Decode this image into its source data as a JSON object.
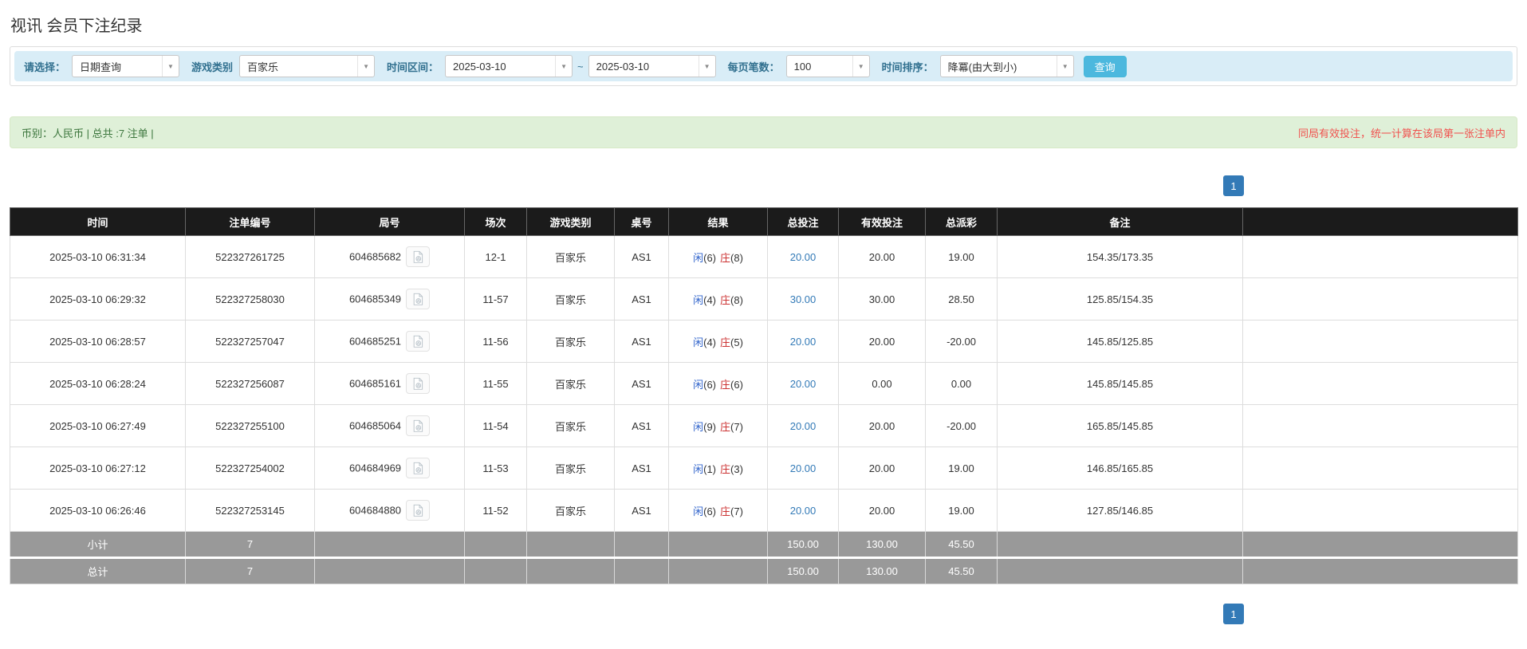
{
  "page": {
    "title": "视讯 会员下注纪录"
  },
  "filters": {
    "query_label": "请选择：",
    "query_value": "日期查询",
    "game_label": "游戏类别",
    "game_value": "百家乐",
    "range_label": "时间区间：",
    "date_from": "2025-03-10",
    "tilde": "~",
    "date_to": "2025-03-10",
    "size_label": "每页笔数：",
    "size_value": "100",
    "sort_label": "时间排序：",
    "sort_value": "降冪(由大到小)",
    "search_label": "查询"
  },
  "summary": {
    "left_text": "币别：人民币 | 总共 :7 注单 |",
    "right_notice": "同局有效投注，统一计算在该局第一张注单内"
  },
  "pagination": {
    "page": "1"
  },
  "table": {
    "headers": [
      "时间",
      "注单编号",
      "局号",
      "场次",
      "游戏类别",
      "桌号",
      "结果",
      "总投注",
      "有效投注",
      "总派彩",
      "备注"
    ],
    "rows": [
      {
        "time": "2025-03-10 06:31:34",
        "bet_id": "522327261725",
        "round_id": "604685682",
        "session": "12-1",
        "game": "百家乐",
        "table_no": "AS1",
        "result": {
          "player_label": "闲",
          "player_score": "(6)",
          "banker_label": "庄",
          "banker_score": "(8)"
        },
        "total_bet": "20.00",
        "valid_bet": "20.00",
        "payout": "19.00",
        "balance": "154.35/173.35"
      },
      {
        "time": "2025-03-10 06:29:32",
        "bet_id": "522327258030",
        "round_id": "604685349",
        "session": "11-57",
        "game": "百家乐",
        "table_no": "AS1",
        "result": {
          "player_label": "闲",
          "player_score": "(4)",
          "banker_label": "庄",
          "banker_score": "(8)"
        },
        "total_bet": "30.00",
        "valid_bet": "30.00",
        "payout": "28.50",
        "balance": "125.85/154.35"
      },
      {
        "time": "2025-03-10 06:28:57",
        "bet_id": "522327257047",
        "round_id": "604685251",
        "session": "11-56",
        "game": "百家乐",
        "table_no": "AS1",
        "result": {
          "player_label": "闲",
          "player_score": "(4)",
          "banker_label": "庄",
          "banker_score": "(5)"
        },
        "total_bet": "20.00",
        "valid_bet": "20.00",
        "payout": "-20.00",
        "balance": "145.85/125.85"
      },
      {
        "time": "2025-03-10 06:28:24",
        "bet_id": "522327256087",
        "round_id": "604685161",
        "session": "11-55",
        "game": "百家乐",
        "table_no": "AS1",
        "result": {
          "player_label": "闲",
          "player_score": "(6)",
          "banker_label": "庄",
          "banker_score": "(6)"
        },
        "total_bet": "20.00",
        "valid_bet": "0.00",
        "payout": "0.00",
        "balance": "145.85/145.85"
      },
      {
        "time": "2025-03-10 06:27:49",
        "bet_id": "522327255100",
        "round_id": "604685064",
        "session": "11-54",
        "game": "百家乐",
        "table_no": "AS1",
        "result": {
          "player_label": "闲",
          "player_score": "(9)",
          "banker_label": "庄",
          "banker_score": "(7)"
        },
        "total_bet": "20.00",
        "valid_bet": "20.00",
        "payout": "-20.00",
        "balance": "165.85/145.85"
      },
      {
        "time": "2025-03-10 06:27:12",
        "bet_id": "522327254002",
        "round_id": "604684969",
        "session": "11-53",
        "game": "百家乐",
        "table_no": "AS1",
        "result": {
          "player_label": "闲",
          "player_score": "(1)",
          "banker_label": "庄",
          "banker_score": "(3)"
        },
        "total_bet": "20.00",
        "valid_bet": "20.00",
        "payout": "19.00",
        "balance": "146.85/165.85"
      },
      {
        "time": "2025-03-10 06:26:46",
        "bet_id": "522327253145",
        "round_id": "604684880",
        "session": "11-52",
        "game": "百家乐",
        "table_no": "AS1",
        "result": {
          "player_label": "闲",
          "player_score": "(6)",
          "banker_label": "庄",
          "banker_score": "(7)"
        },
        "total_bet": "20.00",
        "valid_bet": "20.00",
        "payout": "19.00",
        "balance": "127.85/146.85"
      }
    ],
    "footer": [
      {
        "label": "小计",
        "count": "7",
        "total_bet": "150.00",
        "valid_bet": "130.00",
        "payout": "45.50"
      },
      {
        "label": "总计",
        "count": "7",
        "total_bet": "150.00",
        "valid_bet": "130.00",
        "payout": "45.50"
      }
    ]
  },
  "colors": {
    "header_bg": "#1b1b1b",
    "footer_bg": "#999999",
    "filter_bar_bg": "#d9edf7",
    "filter_label": "#31708f",
    "summary_bg": "#dff0d8",
    "summary_text": "#3c763d",
    "notice_red": "#f0524f",
    "link_blue": "#337ab7",
    "player_blue": "#3366cc",
    "banker_red": "#cc3333",
    "negative_red": "#e82c2c",
    "search_button_bg": "#4cb8de",
    "pagination_bg": "#337ab7"
  }
}
